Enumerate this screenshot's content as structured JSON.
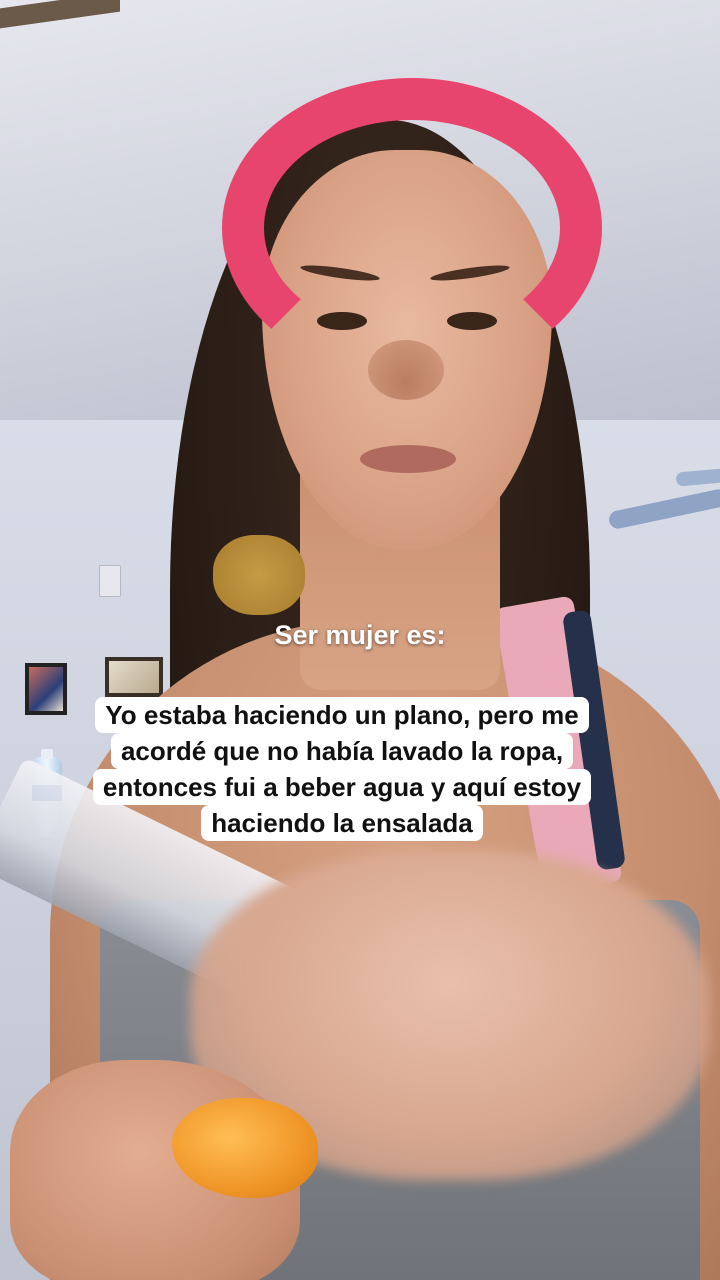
{
  "caption": {
    "title": "Ser mujer es:",
    "lines": [
      "Yo estaba haciendo un plano, pero me",
      "acordé que no había lavado la ropa,",
      "entonces fui a beber agua y aquí estoy",
      "haciendo la ensalada"
    ]
  },
  "colors": {
    "headband": "#e8456e",
    "caption_bg": "#ffffff",
    "caption_text": "#111111",
    "title_text": "#ffffff"
  }
}
